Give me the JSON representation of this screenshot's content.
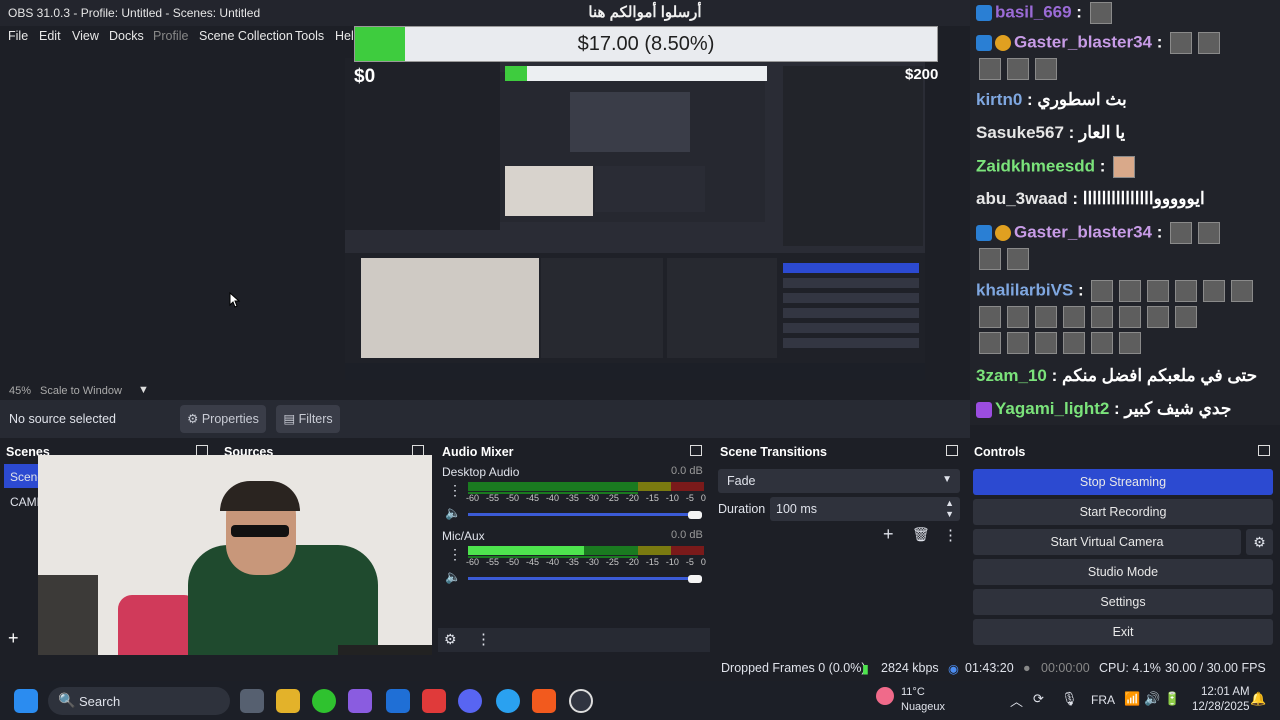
{
  "window": {
    "title": "OBS 31.0.3 - Profile: Untitled - Scenes: Untitled"
  },
  "menu": {
    "file": "File",
    "edit": "Edit",
    "view": "View",
    "docks": "Docks",
    "profile": "Profile",
    "scene_collection": "Scene Collection",
    "tools": "Tools",
    "help": "Help"
  },
  "donation": {
    "title": "أرسلوا أموالكم هنا",
    "amount_label": "$17.00 (8.50%)",
    "progress_percent": 8.5,
    "min": "$0",
    "max": "$200"
  },
  "chat": [
    {
      "user": "basil_669",
      "msg": "",
      "color": "#9b6bd6"
    },
    {
      "user": "Gaster_blaster34",
      "msg": "",
      "color": "#c79be6"
    },
    {
      "user": "kirtn0",
      "msg": "بث اسطوري",
      "color": "#7fa7e0"
    },
    {
      "user": "Sasuke567",
      "msg": "يا العار",
      "color": "#e6e6e6"
    },
    {
      "user": "Zaidkhmeesdd",
      "msg": "",
      "color": "#7be37b"
    },
    {
      "user": "abu_3waad",
      "msg": "ايوووووااااااااااااااا",
      "color": "#e6e6e6"
    },
    {
      "user": "Gaster_blaster34",
      "msg": "",
      "color": "#c79be6"
    },
    {
      "user": "khalilarbiVS",
      "msg": "",
      "color": "#7fa7e0"
    },
    {
      "user": "3zam_10",
      "msg": "حتى في ملعبكم افضل منكم",
      "color": "#7be37b"
    },
    {
      "user": "Yagami_light2",
      "msg": "جدي شيف كبير",
      "color": "#7be37b"
    }
  ],
  "preview": {
    "zoom": "45%",
    "scale_mode": "Scale to Window"
  },
  "source_bar": {
    "no_source": "No source selected",
    "properties": "Properties",
    "filters": "Filters"
  },
  "docks": {
    "scenes": "Scenes",
    "sources": "Sources",
    "audio_mixer": "Audio Mixer",
    "transitions": "Scene Transitions",
    "controls": "Controls"
  },
  "scenes": {
    "items": [
      "Scene",
      "CAME"
    ]
  },
  "mixer": {
    "ticks": [
      "-60",
      "-55",
      "-50",
      "-45",
      "-40",
      "-35",
      "-30",
      "-25",
      "-20",
      "-15",
      "-10",
      "-5",
      "0"
    ],
    "channels": [
      {
        "name": "Desktop Audio",
        "db": "0.0 dB",
        "level": 0
      },
      {
        "name": "Mic/Aux",
        "db": "0.0 dB",
        "level": 0.49
      }
    ]
  },
  "transitions": {
    "type": "Fade",
    "duration_label": "Duration",
    "duration": "100 ms"
  },
  "controls": {
    "stop_streaming": "Stop Streaming",
    "start_recording": "Start Recording",
    "start_virtual_camera": "Start Virtual Camera",
    "studio_mode": "Studio Mode",
    "settings": "Settings",
    "exit": "Exit"
  },
  "status": {
    "dropped": "Dropped Frames 0 (0.0%)",
    "bitrate": "2824 kbps",
    "stream_time": "01:43:20",
    "rec_time": "00:00:00",
    "cpu": "CPU: 4.1%",
    "fps": "30.00 / 30.00 FPS"
  },
  "taskbar": {
    "search": "Search",
    "weather_temp": "11°C",
    "weather_desc": "Nuageux",
    "lang": "FRA",
    "time": "12:01 AM",
    "date": "12/28/2025"
  },
  "colors": {
    "accent": "#3b5bd6",
    "stream_button": "#2c4ad1"
  }
}
